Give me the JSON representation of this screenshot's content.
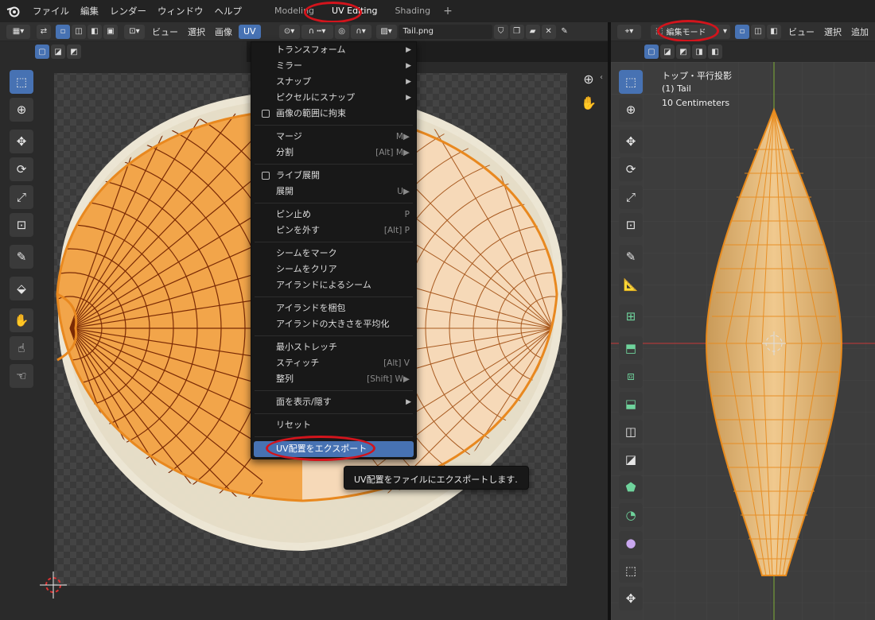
{
  "topbar": {
    "menus": [
      "ファイル",
      "編集",
      "レンダー",
      "ウィンドウ",
      "ヘルプ"
    ],
    "workspaces": [
      "Modeling",
      "UV Editing",
      "Shading"
    ],
    "add_tab": "+"
  },
  "uv_header": {
    "menus": [
      "ビュー",
      "選択",
      "画像",
      "UV"
    ],
    "image_name": "Tail.png"
  },
  "viewport_header": {
    "mode": "編集モード",
    "menus": [
      "ビュー",
      "選択",
      "追加"
    ]
  },
  "viewport_overlay": {
    "view_name": "トップ・平行投影",
    "object_name": "(1) Tail",
    "scale": "10 Centimeters"
  },
  "uv_menu": {
    "items": [
      {
        "label": "トランスフォーム",
        "arrow": "▶"
      },
      {
        "label": "ミラー",
        "arrow": "▶"
      },
      {
        "label": "スナップ",
        "arrow": "▶"
      },
      {
        "label": "ピクセルにスナップ",
        "arrow": "▶"
      },
      {
        "label": "画像の範囲に拘束"
      },
      {
        "label": "マージ",
        "shortcut": "M▶"
      },
      {
        "label": "分割",
        "shortcut": "[Alt] M▶"
      },
      {
        "label": "ライブ展開"
      },
      {
        "label": "展開",
        "shortcut": "U▶"
      },
      {
        "label": "ピン止め",
        "shortcut": "P"
      },
      {
        "label": "ピンを外す",
        "shortcut": "[Alt] P"
      },
      {
        "label": "シームをマーク"
      },
      {
        "label": "シームをクリア"
      },
      {
        "label": "アイランドによるシーム"
      },
      {
        "label": "アイランドを梱包"
      },
      {
        "label": "アイランドの大きさを平均化"
      },
      {
        "label": "最小ストレッチ"
      },
      {
        "label": "スティッチ",
        "shortcut": "[Alt] V"
      },
      {
        "label": "整列",
        "shortcut": "[Shift] W▶"
      },
      {
        "label": "面を表示/隠す",
        "arrow": "▶"
      },
      {
        "label": "リセット"
      },
      {
        "label": "UV配置をエクスポート"
      }
    ]
  },
  "tooltip": "UV配置をファイルにエクスポートします.",
  "colors": {
    "accent": "#4772b3",
    "uv_fill": "#f2a54a",
    "annotation": "#d2141c",
    "mesh": "#e8b56a"
  }
}
